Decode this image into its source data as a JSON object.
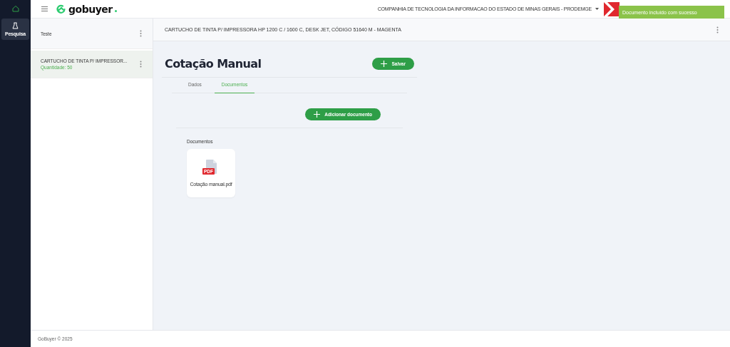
{
  "rail": {
    "items": [
      {
        "kind": "home",
        "selected": false
      },
      {
        "kind": "research",
        "label": "Pesquisa",
        "selected": true
      }
    ]
  },
  "header": {
    "logo": "gobuyer",
    "company": "COMPANHIA DE TECNOLOGIA DA INFORMACAO DO ESTADO DE MINAS GERAIS - PRODEMGE",
    "toast": "Documento incluído com sucesso"
  },
  "list": {
    "items": [
      {
        "title": "Teste",
        "selected": false
      },
      {
        "title": "CARTUCHO DE TINTA P/ IMPRESSOR...",
        "subtitle": "Quantidade: 50",
        "selected": true
      }
    ]
  },
  "main": {
    "product_title": "CARTUCHO DE TINTA P/ IMPRESSORA HP 1200 C / 1600 C, DESK JET, CÓDIGO 51640 M - MAGENTA",
    "heading": "Cotação Manual",
    "save_button": "Salvar",
    "tabs": [
      {
        "label": "Dados",
        "selected": false
      },
      {
        "label": "Documentos",
        "selected": true
      }
    ],
    "add_button": "Adicionar documento",
    "section_label": "Documentos",
    "files": [
      {
        "name": "Cotação manual.pdf",
        "type_label": "PDF"
      }
    ]
  },
  "footer": "GoBuyer © 2025"
}
